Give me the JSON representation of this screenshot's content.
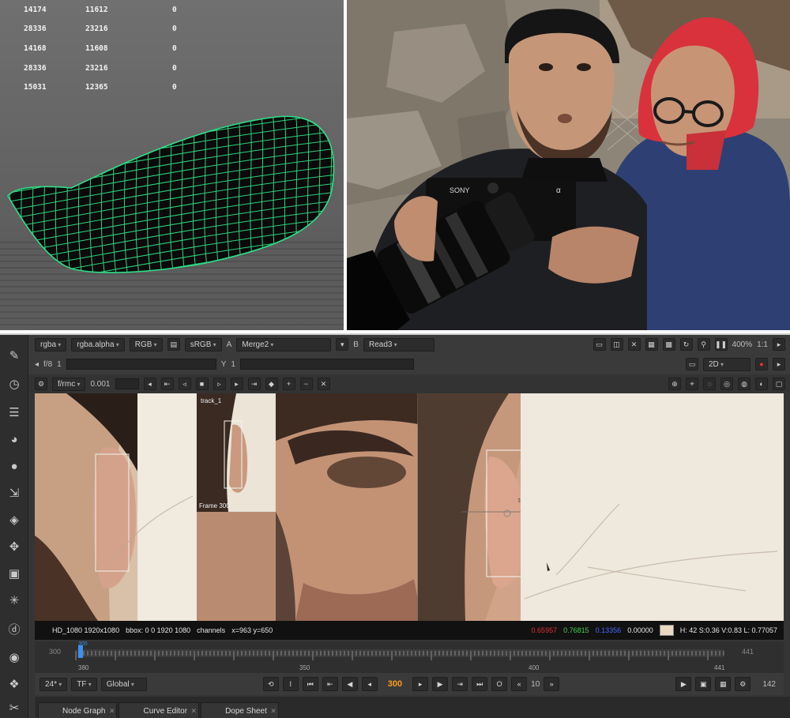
{
  "stats_table": [
    [
      "14174",
      "11612",
      "0"
    ],
    [
      "28336",
      "23216",
      "0"
    ],
    [
      "14168",
      "11608",
      "0"
    ],
    [
      "28336",
      "23216",
      "0"
    ],
    [
      "15031",
      "12365",
      "0"
    ]
  ],
  "camera": {
    "brand": "SONY",
    "mark": "α"
  },
  "viewer_toolbar": {
    "channels": "rgba",
    "channel_alpha": "rgba.alpha",
    "colorspace_mode": "RGB",
    "lut": "sRGB",
    "input_a_label": "A",
    "input_a": "Merge2",
    "input_b_label": "B",
    "input_b": "Read3",
    "zoom": "400%",
    "proxy": "1:1"
  },
  "viewer_toolbar2": {
    "frame_range": "f/8",
    "frame_value": "1",
    "y_label": "Y",
    "y_value": "1",
    "view_mode": "2D"
  },
  "viewer_toolbar3": {
    "exposure_label": "f/rmc",
    "exposure_value": "0.001"
  },
  "viewer_overlays": {
    "inset_label_top": "track_1",
    "inset_label_bottom": "Frame 300",
    "track_label": "track_1"
  },
  "status_bar": {
    "format": "HD_1080 1920x1080",
    "bbox": "bbox: 0 0 1920 1080",
    "channels": "channels",
    "coords": "x=963 y=650",
    "r": "0.65957",
    "g": "0.76815",
    "b": "0.13356",
    "a": "0.00000",
    "hsvl": "H: 42 S:0.36 V:0.83  L: 0.77057",
    "colors": {
      "r": "#e0303a",
      "g": "#46d050",
      "b": "#4a66ff"
    }
  },
  "timeline": {
    "start": "380",
    "end": "441",
    "marks": [
      "300",
      "350",
      "400",
      "441"
    ],
    "in_label": "300",
    "out_label": "441",
    "playhead_label": "300"
  },
  "playback": {
    "fps": "24*",
    "tf": "TF",
    "mode": "Global",
    "current_frame": "300",
    "step": "10",
    "end_frame": "142"
  },
  "panel_tabs": [
    {
      "label": "Node Graph"
    },
    {
      "label": "Curve Editor"
    },
    {
      "label": "Dope Sheet"
    }
  ],
  "tools": [
    "pencil-icon",
    "clock-icon",
    "layers-icon",
    "color-wheel-icon",
    "circle-icon",
    "corner-pin-icon",
    "cube-stack-icon",
    "move-icon",
    "box-icon",
    "star-icon",
    "d-badge-icon",
    "eye-icon",
    "palette-icon",
    "script-icon"
  ]
}
